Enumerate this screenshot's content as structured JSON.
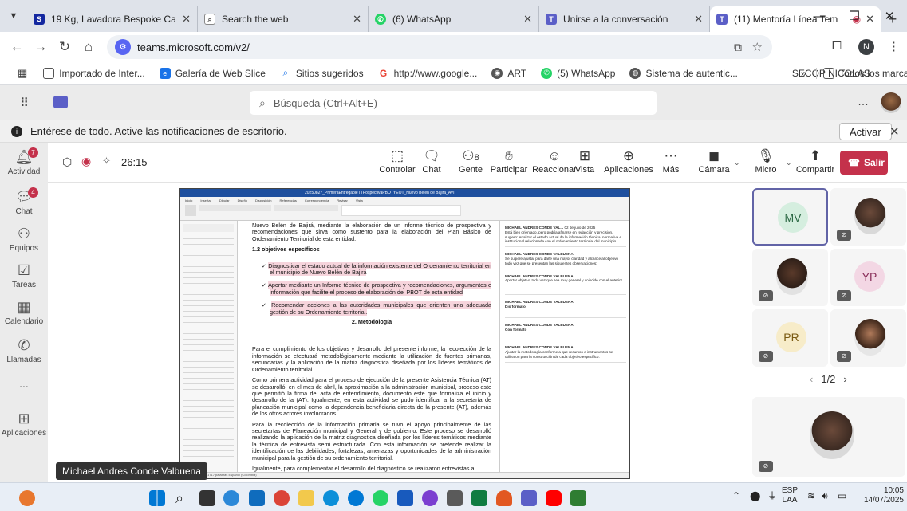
{
  "browser": {
    "tabs": [
      {
        "title": "19 Kg, Lavadora Bespoke Ca",
        "icon": "samsung-icon",
        "active": false
      },
      {
        "title": "Search the web",
        "icon": "search-icon",
        "active": false
      },
      {
        "title": "(6) WhatsApp",
        "icon": "whatsapp-icon",
        "active": false
      },
      {
        "title": "Unirse a la conversación",
        "icon": "teams-icon",
        "active": false
      },
      {
        "title": "(11) Mentoría Línea Tem",
        "icon": "teams-icon",
        "active": true
      }
    ],
    "url": "teams.microsoft.com/v2/",
    "bookmarks": [
      "Importado de Inter...",
      "Galería de Web Slice",
      "Sitios sugeridos",
      "http://www.google...",
      "ART",
      "(5) WhatsApp",
      "Sistema de autentic...",
      "SECOP NICOLAS"
    ],
    "bookmarks_more": "»",
    "all_bookmarks": "Todos los marcadores",
    "profile_letter": "N"
  },
  "teams": {
    "search_placeholder": "Búsqueda (Ctrl+Alt+E)",
    "notification": "Entérese de todo. Active las notificaciones de escritorio.",
    "activate_label": "Activar",
    "rail": [
      {
        "label": "Actividad",
        "badge": "7"
      },
      {
        "label": "Chat",
        "badge": "4"
      },
      {
        "label": "Equipos",
        "badge": ""
      },
      {
        "label": "Tareas",
        "badge": ""
      },
      {
        "label": "Calendario",
        "badge": ""
      },
      {
        "label": "Llamadas",
        "badge": ""
      },
      {
        "label": "...",
        "badge": ""
      },
      {
        "label": "Aplicaciones",
        "badge": ""
      }
    ],
    "meeting": {
      "timer": "26:15",
      "people_count": "8",
      "controls": [
        "Controlar",
        "Chat",
        "Gente",
        "Participar",
        "Reaccionar",
        "Vista",
        "Aplicaciones",
        "Más",
        "Cámara",
        "Micro",
        "Compartir"
      ],
      "leave_label": "Salir",
      "presenter": "Michael Andres Conde Valbuena",
      "page_indicator": "1/2"
    },
    "participants": [
      {
        "initials": "MV",
        "color": "#d5eedf",
        "text_color": "#2f6b47",
        "active": true
      },
      {
        "initials": "",
        "photo": true
      },
      {
        "initials": "",
        "photo": true
      },
      {
        "initials": "YP",
        "color": "#f3d7e4",
        "text_color": "#8a2f5a"
      },
      {
        "initials": "PR",
        "color": "#f7ecc9",
        "text_color": "#7a5a12"
      },
      {
        "initials": "",
        "photo": true
      },
      {
        "initials": "",
        "photo": true
      }
    ]
  },
  "shared_doc": {
    "title": "20250827_PrimeraEntregableTTPospectivaPBOTYEOT_Nuevo Belen de Bajira_AVI",
    "intro": "Nuevo Belén de Bajirá, mediante la elaboración de un informe técnico de prospectiva y recomendaciones que sirva como sustento para la elaboración del Plan Básico de Ordenamiento Territorial de esta entidad.",
    "section_objectives": "1.2 objetivos específicos",
    "objectives": [
      "Diagnosticar el estado actual de la información existente del Ordenamiento territorial en el municipio de Nuevo Belén de Bajirá",
      "Aportar mediante un Informe técnico de prospectiva y recomendaciones, argumentos e información que facilite el proceso de elaboración del PBOT de esta entidad",
      "Recomendar acciones a las autoridades municipales que orienten una adecuada gestión de su Ordenamiento territorial."
    ],
    "section_method": "2. Metodología",
    "paragraphs": [
      "Para el cumplimiento de los objetivos y desarrollo del presente informe, la recolección de la información se efectuará metodológicamente mediante la utilización de fuentes primarias, secundarias y la aplicación de la matriz diagnostica diseñada por los líderes temáticos de Ordenamiento territorial.",
      "Como primera actividad para el proceso de ejecución de la presente Asistencia Técnica (AT) se desarrolló, en el mes de abril, la aproximación a la administración municipal, proceso este que permitió la firma del acta de entendimiento, documento este que formaliza el inicio y desarrollo de la (AT). Igualmente, en esta actividad se pudo identificar a la secretaría de planeación municipal como la dependencia beneficiaria directa de la presente (AT), además de los otros actores involucrados.",
      "Para la recolección de la información primaria se tuvo el apoyo principalmente de las secretarías de Planeación municipal y General y de gobierno. Este proceso se desarrolló realizando la aplicación de la matriz diagnostica diseñada por los líderes temáticos mediante la técnica de entrevista semi estructurada. Con esta información se pretende realizar la identificación de las debilidades, fortalezas, amenazas y oportunidades de la administración municipal para la gestión de su ordenamiento territorial.",
      "Igualmente, para complementar el desarrollo del diagnóstico se realizaron entrevistas a"
    ],
    "comments": [
      {
        "author": "MICHAEL ANDRES CONDE VAL...",
        "date": "02 de julio de 2025",
        "text": "Está bien orientado, pero podría afinarse en redacción y precisión, sugiero: Analizar el estado actual de la información técnica, normativa e institucional relacionada con el ordenamiento territorial del municipio."
      },
      {
        "author": "MICHAEL ANDRES CONDE VALBUENA",
        "date": "",
        "text": "Se sugiere ajustar para darle una mayor claridad y alcance al objetivo todo vez que se presentan las siguientes observaciones:"
      },
      {
        "author": "MICHAEL ANDRES CONDE VALBUENA",
        "date": "",
        "text": "Aportar objetivo toda vez que sea muy general y coincide con el anterior"
      },
      {
        "author": "MICHAEL ANDRES CONDE VALBUENA",
        "date": "",
        "text": "Dio formato"
      },
      {
        "author": "MICHAEL ANDRES CONDE VALBUENA",
        "date": "",
        "text": "Con formato"
      },
      {
        "author": "MICHAEL ANDRES CONDE VALBUENA",
        "date": "",
        "text": "Ajustar la metodología conforme a que recursos e instrumentos se utilizaron para la construcción de cada objetivo específico."
      }
    ],
    "status": "Página 6 de 18   1717 palabras   Español (Colombia)"
  },
  "taskbar": {
    "language": "ESP",
    "layout": "LAA",
    "time": "10:05",
    "date": "14/07/2025"
  }
}
